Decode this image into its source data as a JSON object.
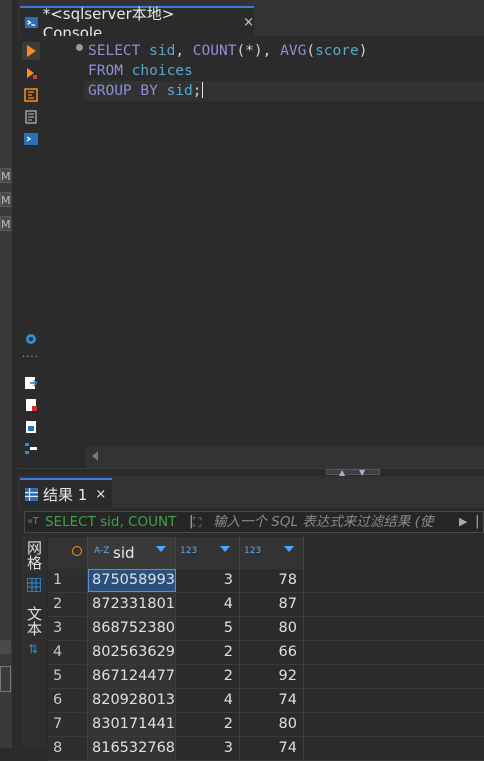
{
  "editor_tab": {
    "title": "*<sqlserver本地> Console",
    "close": "×"
  },
  "outer_strip": {
    "labels": [
      "M",
      "M",
      "M"
    ]
  },
  "code": {
    "line1": {
      "kw1": "SELECT",
      "col1": "sid",
      "fn": "COUNT",
      "fn_arg": "(*)",
      "fn2": "AVG",
      "col2": "score"
    },
    "line2": {
      "kw": "FROM",
      "table": "choices"
    },
    "line3": {
      "kw": "GROUP BY",
      "col": "sid"
    }
  },
  "results_tab": {
    "title": "结果 1",
    "close": "×"
  },
  "filter": {
    "query_preview": "SELECT sid, COUNT",
    "placeholder": "输入一个 SQL 表达式来过滤结果 (使"
  },
  "side_tabs": {
    "grid_label": "网格",
    "text_label": "文本"
  },
  "grid": {
    "columns": [
      {
        "name": "sid",
        "type": "A-Z"
      },
      {
        "name": "",
        "type": "123"
      },
      {
        "name": "",
        "type": "123"
      }
    ],
    "rows": [
      {
        "n": "1",
        "sid": "875058993",
        "count": "3",
        "avg": "78"
      },
      {
        "n": "2",
        "sid": "872331801",
        "count": "4",
        "avg": "87"
      },
      {
        "n": "3",
        "sid": "868752380",
        "count": "5",
        "avg": "80"
      },
      {
        "n": "4",
        "sid": "802563629",
        "count": "2",
        "avg": "66"
      },
      {
        "n": "5",
        "sid": "867124477",
        "count": "2",
        "avg": "92"
      },
      {
        "n": "6",
        "sid": "820928013",
        "count": "4",
        "avg": "74"
      },
      {
        "n": "7",
        "sid": "830171441",
        "count": "2",
        "avg": "80"
      },
      {
        "n": "8",
        "sid": "816532768",
        "count": "3",
        "avg": "74"
      }
    ]
  },
  "colors": {
    "accent": "#3d7bd6",
    "keyword": "#8f8fd6",
    "identifier": "#5aa7c9",
    "run": "#ff8c1a"
  }
}
